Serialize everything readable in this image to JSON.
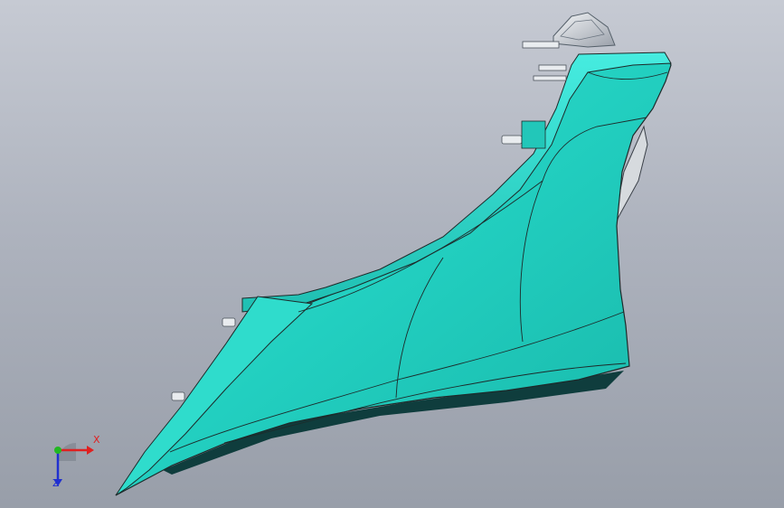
{
  "viewport": {
    "background_top": "#c6cad3",
    "background_bottom": "#989ea9"
  },
  "model": {
    "part_color": "#26d6c6",
    "edge_color": "#1d2a2a",
    "shadow_color": "#0f3d3d",
    "hardware_color": "#e9ecef"
  },
  "triad": {
    "x_label": "X",
    "z_label": "Z",
    "x_color": "#e02020",
    "y_color": "#22b822",
    "z_color": "#2030d0"
  }
}
